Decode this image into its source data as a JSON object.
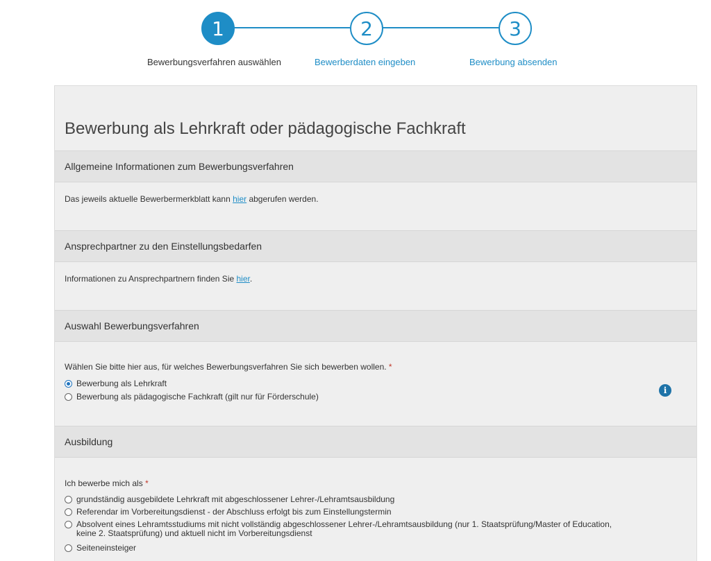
{
  "stepper": {
    "steps": [
      {
        "number": "1",
        "label": "Bewerbungsverfahren auswählen",
        "state": "active"
      },
      {
        "number": "2",
        "label": "Bewerberdaten eingeben",
        "state": "pending"
      },
      {
        "number": "3",
        "label": "Bewerbung absenden",
        "state": "pending"
      }
    ]
  },
  "page": {
    "title": "Bewerbung als Lehrkraft oder pädagogische Fachkraft"
  },
  "sections": {
    "general": {
      "header": "Allgemeine Informationen zum Bewerbungsverfahren",
      "text_before": "Das jeweils aktuelle Bewerbermerkblatt kann ",
      "link": "hier",
      "text_after": " abgerufen werden."
    },
    "contacts": {
      "header": "Ansprechpartner zu den Einstellungsbedarfen",
      "text_before": "Informationen zu Ansprechpartnern finden Sie ",
      "link": "hier",
      "text_after": "."
    },
    "procedure": {
      "header": "Auswahl Bewerbungsverfahren",
      "question": "Wählen Sie bitte hier aus, für welches Bewerbungsverfahren Sie sich bewerben wollen. ",
      "required_mark": "*",
      "options": [
        {
          "label": "Bewerbung als Lehrkraft",
          "checked": true
        },
        {
          "label": "Bewerbung als pädagogische Fachkraft (gilt nur für Förderschule)",
          "checked": false
        }
      ],
      "info_icon": "info-circle-icon"
    },
    "training": {
      "header": "Ausbildung",
      "question": "Ich bewerbe mich als ",
      "required_mark": "*",
      "options": [
        {
          "label": "grundständig ausgebildete Lehrkraft mit abgeschlossener Lehrer-/Lehramtsausbildung",
          "checked": false
        },
        {
          "label": "Referendar im Vorbereitungsdienst - der Abschluss erfolgt bis zum Einstellungstermin",
          "checked": false
        },
        {
          "label": "Absolvent eines Lehramtsstudiums mit nicht vollständig abgeschlossener Lehrer-/Lehramtsausbildung (nur 1. Staatsprüfung/Master of Education, keine 2. Staatsprüfung) und aktuell nicht im Vorbereitungsdienst",
          "checked": false
        },
        {
          "label": "Seiteneinsteiger",
          "checked": false
        }
      ]
    }
  },
  "colors": {
    "accent": "#1e8dc6",
    "panel_bg": "#efefef",
    "section_header_bg": "#e3e3e3"
  }
}
